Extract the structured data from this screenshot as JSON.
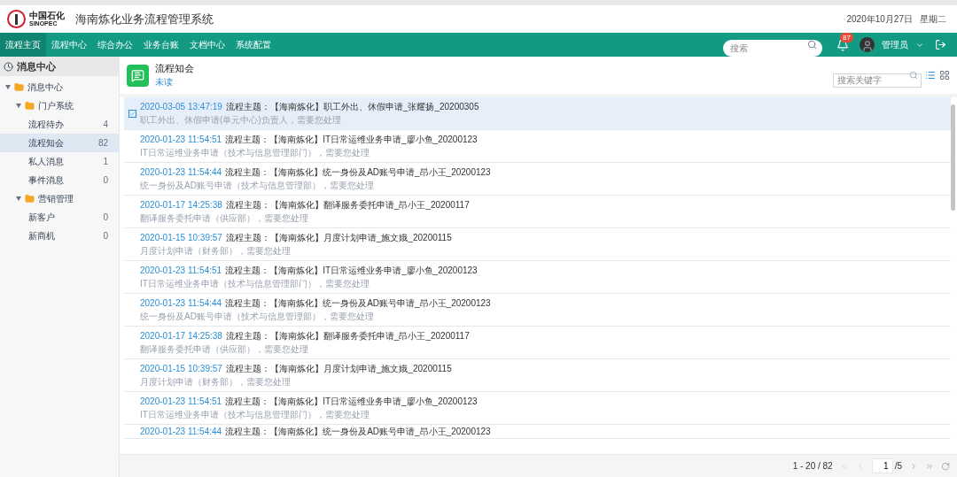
{
  "header": {
    "logo_cn": "中国石化",
    "logo_en": "SINOPEC",
    "title": "海南炼化业务流程管理系统",
    "date": "2020年10月27日",
    "weekday": "星期二"
  },
  "nav": [
    {
      "label": "流程主页",
      "selected": true
    },
    {
      "label": "流程中心",
      "selected": false
    },
    {
      "label": "综合办公",
      "selected": false
    },
    {
      "label": "业务台账",
      "selected": false
    },
    {
      "label": "文档中心",
      "selected": false
    },
    {
      "label": "系统配置",
      "selected": false
    }
  ],
  "top_search": {
    "placeholder": "搜索"
  },
  "notifications": {
    "count": "87"
  },
  "user": {
    "name": "管理员"
  },
  "sidebar": {
    "title": "消息中心",
    "tree": [
      {
        "label": "消息中心",
        "expanded": true,
        "children": [
          {
            "label": "门户系统",
            "expanded": true,
            "children": [
              {
                "label": "流程待办",
                "count": "4",
                "selected": false
              },
              {
                "label": "流程知会",
                "count": "82",
                "selected": true
              },
              {
                "label": "私人消息",
                "count": "1",
                "selected": false
              },
              {
                "label": "事件消息",
                "count": "0",
                "selected": false
              }
            ]
          },
          {
            "label": "营销管理",
            "expanded": true,
            "children": [
              {
                "label": "新客户",
                "count": "0",
                "selected": false
              },
              {
                "label": "新商机",
                "count": "0",
                "selected": false
              }
            ]
          }
        ]
      }
    ]
  },
  "panel": {
    "title": "流程知会",
    "subtitle": "未读",
    "search": {
      "placeholder": "搜索关键字"
    },
    "view": [
      {
        "kind": "list",
        "selected": true
      },
      {
        "kind": "grid",
        "selected": false
      }
    ]
  },
  "messages": [
    {
      "time": "2020-03-05 13:47:19",
      "subject": "流程主题：【海南炼化】职工外出、休假申请_张耀扬_20200305",
      "detail": "职工外出、休假申请(单元中心)负责人，需要您处理",
      "selected": true
    },
    {
      "time": "2020-01-23 11:54:51",
      "subject": "流程主题：【海南炼化】IT日常运维业务申请_廖小鱼_20200123",
      "detail": "IT日常运维业务申请（技术与信息管理部门），需要您处理",
      "selected": false
    },
    {
      "time": "2020-01-23 11:54:44",
      "subject": "流程主题：【海南炼化】统一身份及AD账号申请_昂小王_20200123",
      "detail": "统一身份及AD账号申请（技术与信息管理部），需要您处理",
      "selected": false
    },
    {
      "time": "2020-01-17 14:25:38",
      "subject": "流程主题：【海南炼化】翻译服务委托申请_昂小王_20200117",
      "detail": "翻译服务委托申请（供应部），需要您处理",
      "selected": false
    },
    {
      "time": "2020-01-15 10:39:57",
      "subject": "流程主题：【海南炼化】月度计划申请_施文娥_20200115",
      "detail": "月度计划申请（财务部），需要您处理",
      "selected": false
    },
    {
      "time": "2020-01-23 11:54:51",
      "subject": "流程主题：【海南炼化】IT日常运维业务申请_廖小鱼_20200123",
      "detail": "IT日常运维业务申请（技术与信息管理部门），需要您处理",
      "selected": false
    },
    {
      "time": "2020-01-23 11:54:44",
      "subject": "流程主题：【海南炼化】统一身份及AD账号申请_昂小王_20200123",
      "detail": "统一身份及AD账号申请（技术与信息管理部），需要您处理",
      "selected": false
    },
    {
      "time": "2020-01-17 14:25:38",
      "subject": "流程主题：【海南炼化】翻译服务委托申请_昂小王_20200117",
      "detail": "翻译服务委托申请（供应部），需要您处理",
      "selected": false
    },
    {
      "time": "2020-01-15 10:39:57",
      "subject": "流程主题：【海南炼化】月度计划申请_施文娥_20200115",
      "detail": "月度计划申请（财务部），需要您处理",
      "selected": false
    },
    {
      "time": "2020-01-23 11:54:51",
      "subject": "流程主题：【海南炼化】IT日常运维业务申请_廖小鱼_20200123",
      "detail": "IT日常运维业务申请（技术与信息管理部门），需要您处理",
      "selected": false
    },
    {
      "time": "2020-01-23 11:54:44",
      "subject": "流程主题：【海南炼化】统一身份及AD账号申请_昂小王_20200123",
      "selected": false
    }
  ],
  "pagination": {
    "range": "1 - 20 / 82",
    "page": "1",
    "pages": "/5"
  }
}
